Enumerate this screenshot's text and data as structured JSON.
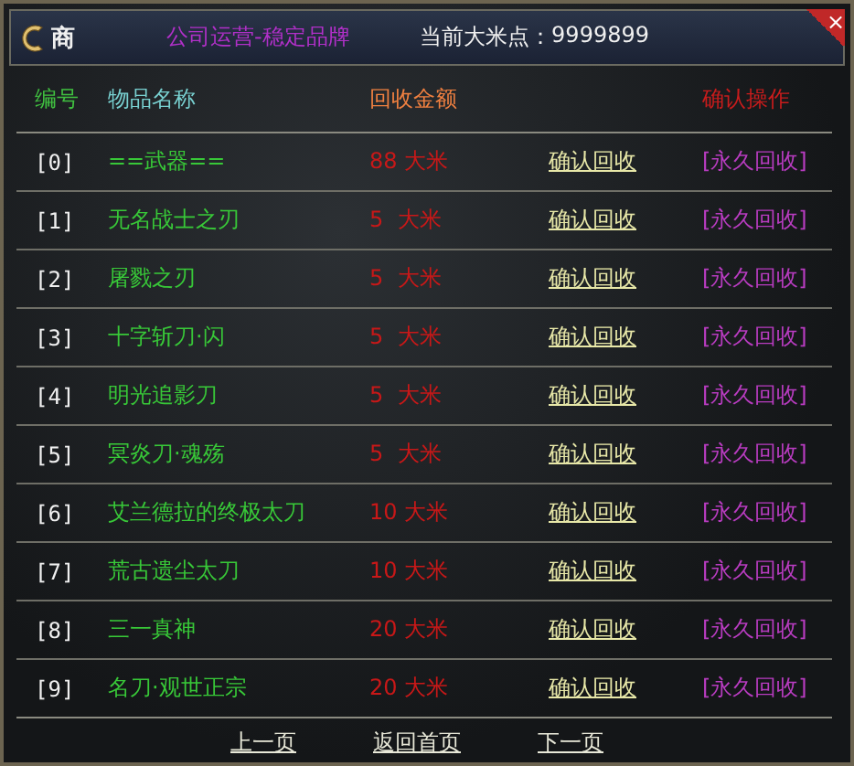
{
  "title_bar": {
    "badge": "商",
    "slogan": "公司运营-稳定品牌",
    "points_label": "当前大米点：",
    "points": "9999899",
    "close": "×"
  },
  "table": {
    "columns": [
      "编号",
      "物品名称",
      "回收金额",
      "确认操作"
    ],
    "rows": [
      {
        "index": "[0]",
        "name": "==武器==",
        "amount": "88 大米",
        "confirm": "确认回收",
        "permanent": "[永久回收]"
      },
      {
        "index": "[1]",
        "name": "无名战士之刃",
        "amount": "5  大米",
        "confirm": "确认回收",
        "permanent": "[永久回收]"
      },
      {
        "index": "[2]",
        "name": "屠戮之刃",
        "amount": "5  大米",
        "confirm": "确认回收",
        "permanent": "[永久回收]"
      },
      {
        "index": "[3]",
        "name": "十字斩刀·闪",
        "amount": "5  大米",
        "confirm": "确认回收",
        "permanent": "[永久回收]"
      },
      {
        "index": "[4]",
        "name": "明光追影刀",
        "amount": "5  大米",
        "confirm": "确认回收",
        "permanent": "[永久回收]"
      },
      {
        "index": "[5]",
        "name": "冥炎刀·魂殇",
        "amount": "5  大米",
        "confirm": "确认回收",
        "permanent": "[永久回收]"
      },
      {
        "index": "[6]",
        "name": "艾兰德拉的终极太刀",
        "amount": "10 大米",
        "confirm": "确认回收",
        "permanent": "[永久回收]"
      },
      {
        "index": "[7]",
        "name": "荒古遗尘太刀",
        "amount": "10 大米",
        "confirm": "确认回收",
        "permanent": "[永久回收]"
      },
      {
        "index": "[8]",
        "name": "三一真神",
        "amount": "20 大米",
        "confirm": "确认回收",
        "permanent": "[永久回收]"
      },
      {
        "index": "[9]",
        "name": "名刀·观世正宗",
        "amount": "20 大米",
        "confirm": "确认回收",
        "permanent": "[永久回收]"
      }
    ]
  },
  "pager": [
    "上一页",
    "返回首页",
    "下一页"
  ]
}
